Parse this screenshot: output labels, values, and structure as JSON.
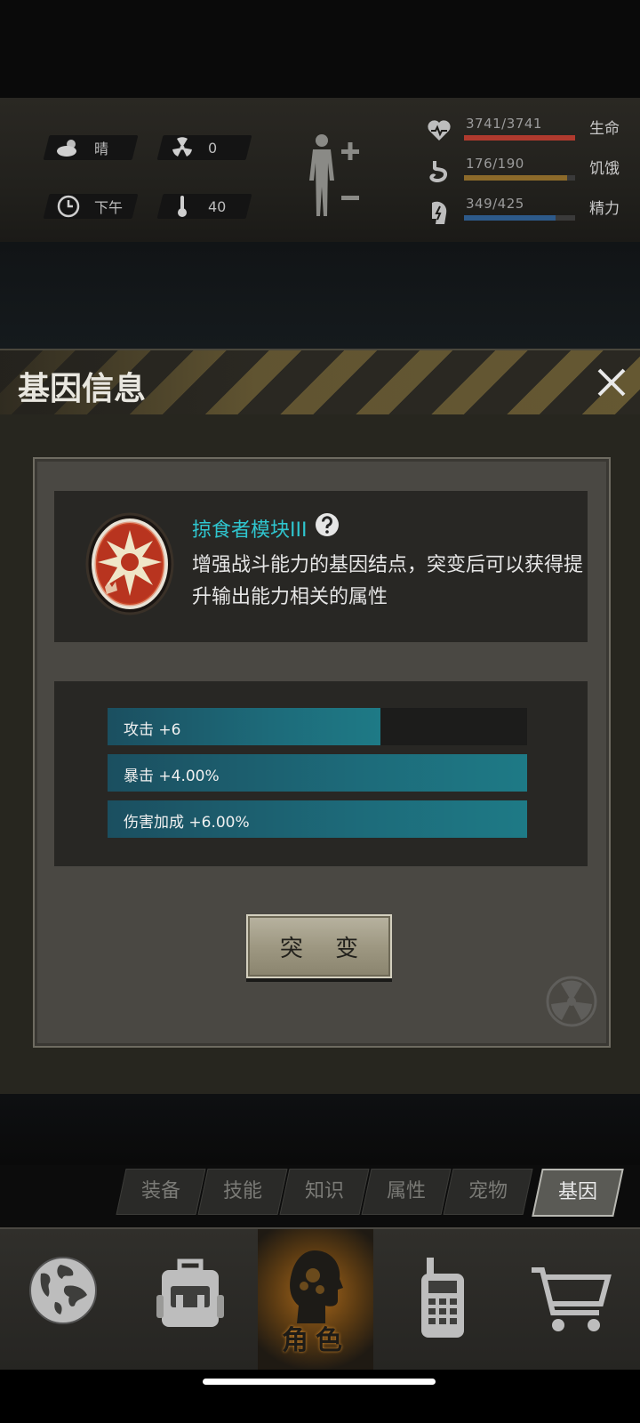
{
  "hud": {
    "weather": "晴",
    "radiation": "0",
    "time_of_day": "下午",
    "temperature": "40",
    "stats": [
      {
        "label": "生命",
        "value": "3741/3741",
        "fill": 1.0,
        "color": "#b03a2e",
        "icon": "heart-icon"
      },
      {
        "label": "饥饿",
        "value": "176/190",
        "fill": 0.926,
        "color": "#8c6a2a",
        "icon": "stomach-icon"
      },
      {
        "label": "精力",
        "value": "349/425",
        "fill": 0.821,
        "color": "#2d5a8a",
        "icon": "energy-icon"
      }
    ]
  },
  "panel": {
    "title": "基因信息",
    "gene_name": "掠食者模块III",
    "description": "增强战斗能力的基因结点，突变后可以获得提升输出能力相关的属性",
    "attributes": [
      {
        "label": "攻击 +6",
        "fill": 0.65
      },
      {
        "label": "暴击 +4.00%",
        "fill": 1.0
      },
      {
        "label": "伤害加成 +6.00%",
        "fill": 1.0
      }
    ],
    "mutate_button": "突 变"
  },
  "tabs": [
    {
      "label": "装备",
      "active": false
    },
    {
      "label": "技能",
      "active": false
    },
    {
      "label": "知识",
      "active": false
    },
    {
      "label": "属性",
      "active": false
    },
    {
      "label": "宠物",
      "active": false
    },
    {
      "label": "基因",
      "active": true
    }
  ],
  "nav": {
    "items": [
      "globe-icon",
      "backpack-icon",
      "character-icon",
      "radio-icon",
      "cart-icon"
    ],
    "active_label": "角色"
  }
}
